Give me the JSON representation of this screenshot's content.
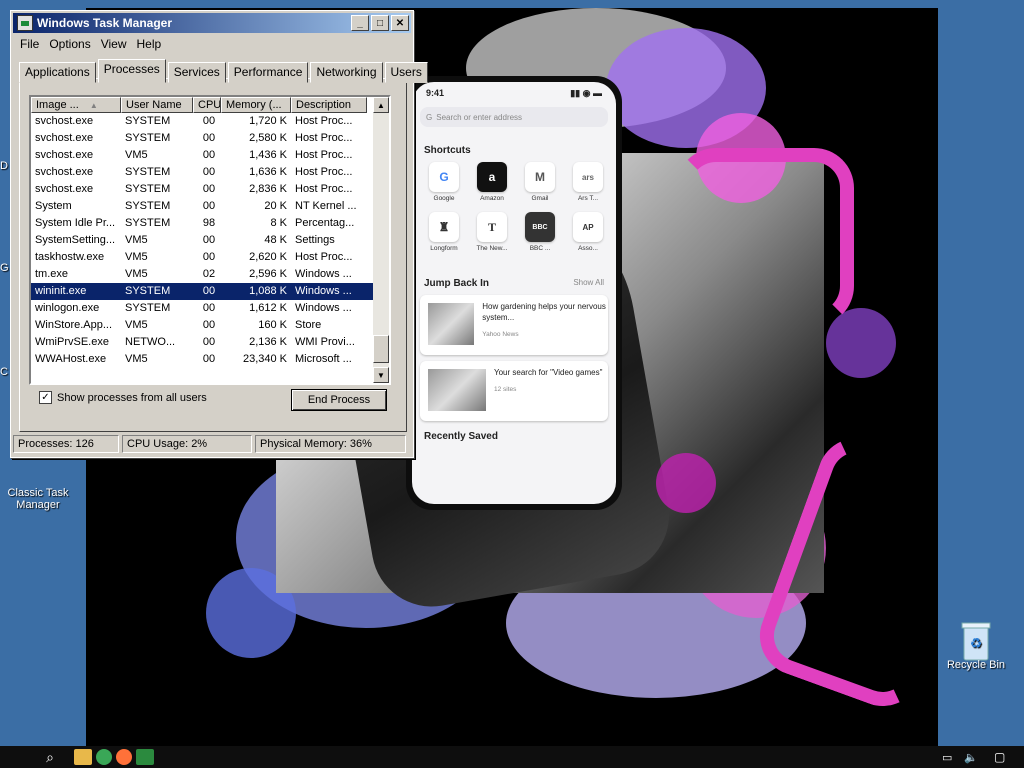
{
  "desktop": {
    "icons": [
      {
        "label": "Classic Task Manager",
        "icon": "task-manager-icon"
      },
      {
        "label": "Recycle Bin",
        "icon": "recycle-bin-icon"
      }
    ],
    "cut_labels": [
      "D",
      "G",
      "C"
    ]
  },
  "task_manager": {
    "title": "Windows Task Manager",
    "menu": [
      "File",
      "Options",
      "View",
      "Help"
    ],
    "tabs": [
      "Applications",
      "Processes",
      "Services",
      "Performance",
      "Networking",
      "Users"
    ],
    "active_tab": "Processes",
    "columns": [
      "Image ...",
      "User Name",
      "CPU",
      "Memory (...",
      "Description"
    ],
    "rows": [
      {
        "image": "svchost.exe",
        "user": "SYSTEM",
        "cpu": "00",
        "mem": "1,720 K",
        "desc": "Host Proc..."
      },
      {
        "image": "svchost.exe",
        "user": "SYSTEM",
        "cpu": "00",
        "mem": "2,580 K",
        "desc": "Host Proc..."
      },
      {
        "image": "svchost.exe",
        "user": "VM5",
        "cpu": "00",
        "mem": "1,436 K",
        "desc": "Host Proc..."
      },
      {
        "image": "svchost.exe",
        "user": "SYSTEM",
        "cpu": "00",
        "mem": "1,636 K",
        "desc": "Host Proc..."
      },
      {
        "image": "svchost.exe",
        "user": "SYSTEM",
        "cpu": "00",
        "mem": "2,836 K",
        "desc": "Host Proc..."
      },
      {
        "image": "System",
        "user": "SYSTEM",
        "cpu": "00",
        "mem": "20 K",
        "desc": "NT Kernel ..."
      },
      {
        "image": "System Idle Pr...",
        "user": "SYSTEM",
        "cpu": "98",
        "mem": "8 K",
        "desc": "Percentag..."
      },
      {
        "image": "SystemSetting...",
        "user": "VM5",
        "cpu": "00",
        "mem": "48 K",
        "desc": "Settings"
      },
      {
        "image": "taskhostw.exe",
        "user": "VM5",
        "cpu": "00",
        "mem": "2,620 K",
        "desc": "Host Proc..."
      },
      {
        "image": "tm.exe",
        "user": "VM5",
        "cpu": "02",
        "mem": "2,596 K",
        "desc": "Windows ..."
      },
      {
        "image": "wininit.exe",
        "user": "SYSTEM",
        "cpu": "00",
        "mem": "1,088 K",
        "desc": "Windows ..."
      },
      {
        "image": "winlogon.exe",
        "user": "SYSTEM",
        "cpu": "00",
        "mem": "1,612 K",
        "desc": "Windows ..."
      },
      {
        "image": "WinStore.App...",
        "user": "VM5",
        "cpu": "00",
        "mem": "160 K",
        "desc": "Store"
      },
      {
        "image": "WmiPrvSE.exe",
        "user": "NETWO...",
        "cpu": "00",
        "mem": "2,136 K",
        "desc": "WMI Provi..."
      },
      {
        "image": "WWAHost.exe",
        "user": "VM5",
        "cpu": "00",
        "mem": "23,340 K",
        "desc": "Microsoft ..."
      }
    ],
    "selected_row": "wininit.exe",
    "show_all_label": "Show processes from all users",
    "show_all_checked": true,
    "end_process_label": "End Process",
    "status": {
      "processes": "Processes: 126",
      "cpu": "CPU Usage: 2%",
      "memory": "Physical Memory: 36%"
    }
  },
  "phone": {
    "time": "9:41",
    "search_placeholder": "Search or enter address",
    "shortcuts_title": "Shortcuts",
    "shortcuts": [
      {
        "label": "Google",
        "glyph": "G"
      },
      {
        "label": "Amazon",
        "glyph": "a"
      },
      {
        "label": "Gmail",
        "glyph": "M"
      },
      {
        "label": "Ars T...",
        "glyph": "ars"
      },
      {
        "label": "Longform",
        "glyph": "♜"
      },
      {
        "label": "The New...",
        "glyph": "T"
      },
      {
        "label": "BBC ...",
        "glyph": "BBC"
      },
      {
        "label": "Asso...",
        "glyph": "AP"
      }
    ],
    "jump_back_title": "Jump Back In",
    "show_all": "Show All",
    "cards": [
      {
        "title": "How gardening helps your nervous system...",
        "sub": "Yahoo News"
      },
      {
        "title": "Your search for \"Video games\"",
        "sub": "12 sites"
      }
    ],
    "recently_saved": "Recently Saved"
  },
  "colors": {
    "desktop_bg": "#3b6ea5",
    "title_bar": "#0a246a",
    "selection": "#0a246a",
    "accent_pink": "#e040c0",
    "accent_purple": "#8a5cf0"
  }
}
